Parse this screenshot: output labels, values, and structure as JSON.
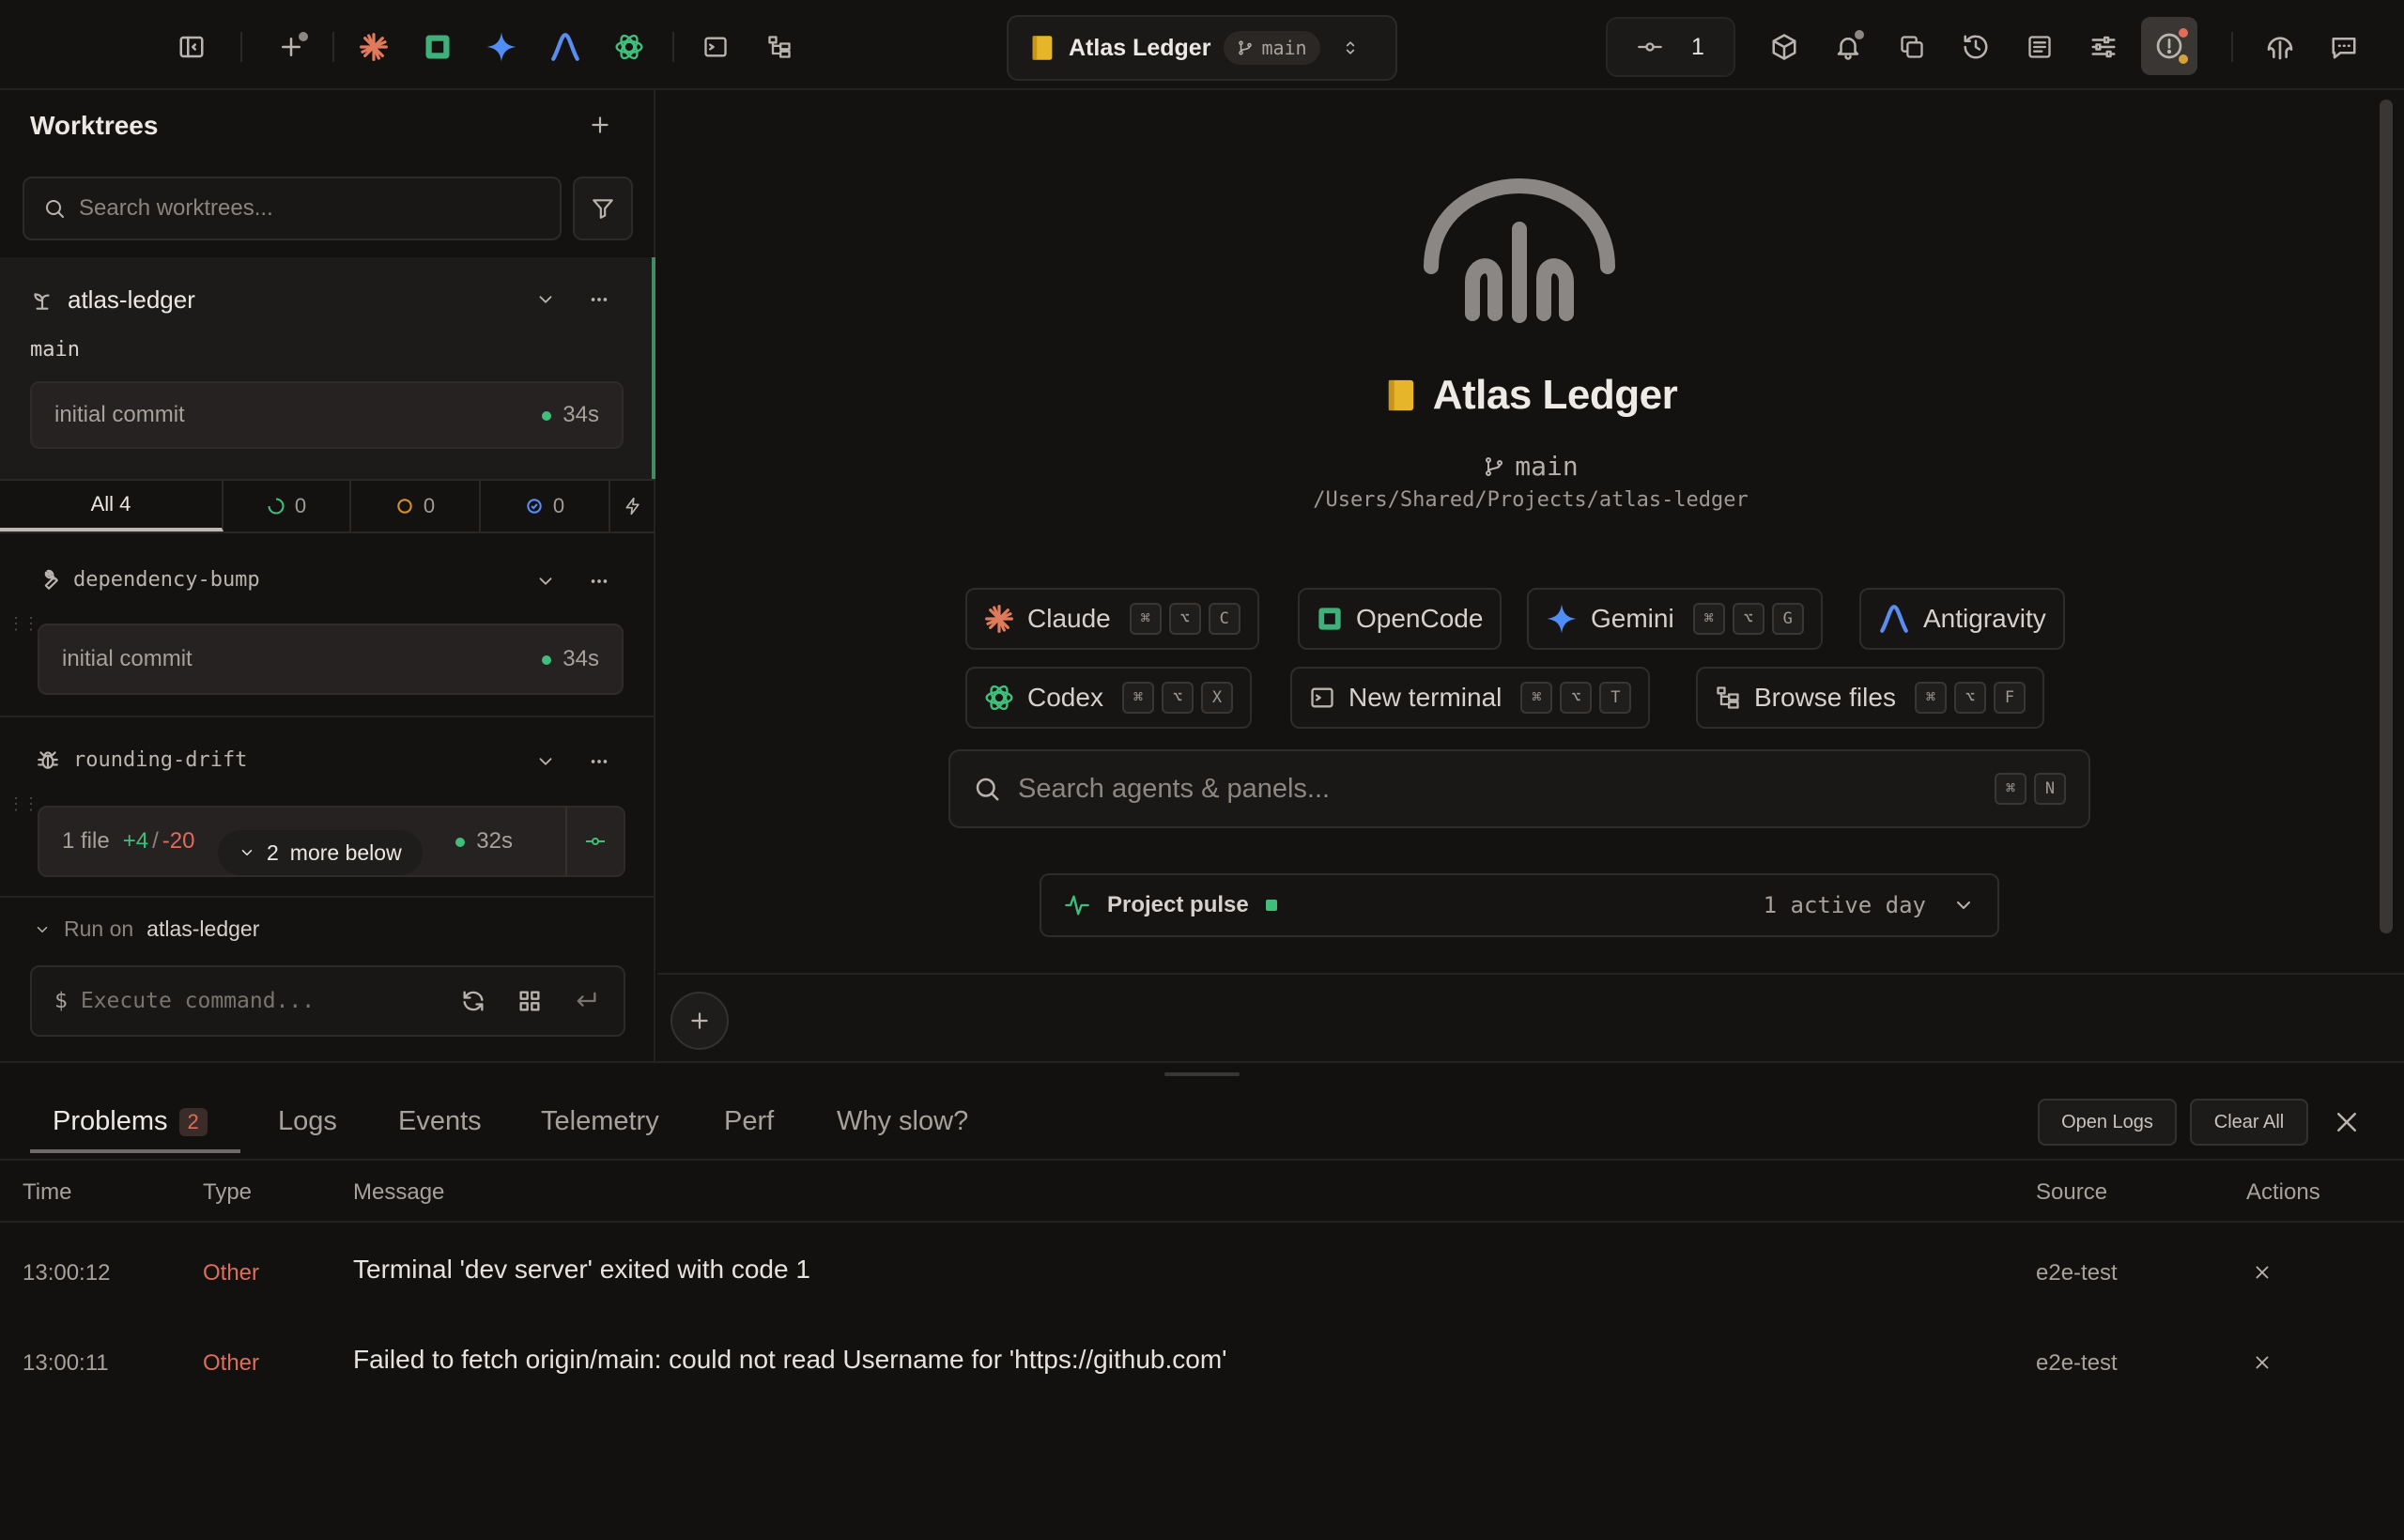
{
  "app": {
    "project_name": "Atlas Ledger",
    "branch": "main",
    "commit_counter": "1",
    "accent_green": "#3fbf7a",
    "error_red": "#e06c5a"
  },
  "toolbar": {
    "left_icons": [
      "sidebar-toggle-icon",
      "new-worktree-icon",
      "claude-icon",
      "opencode-icon",
      "gemini-icon",
      "antigravity-icon",
      "codex-icon",
      "terminal-icon",
      "file-tree-icon"
    ],
    "right_icons": [
      "box-icon",
      "bell-icon",
      "copy-icon",
      "history-icon",
      "list-icon",
      "sliders-icon",
      "alert-icon",
      "remote-icon",
      "chat-icon"
    ]
  },
  "sidebar": {
    "title": "Worktrees",
    "search_placeholder": "Search worktrees...",
    "main_worktree": {
      "name": "atlas-ledger",
      "branch": "main",
      "last_commit": "initial commit",
      "age": "34s"
    },
    "filters": [
      {
        "label": "All 4"
      },
      {
        "label": "0"
      },
      {
        "label": "0"
      },
      {
        "label": "0"
      }
    ],
    "worktrees": [
      {
        "name": "dependency-bump",
        "last_commit": "initial commit",
        "age": "34s"
      },
      {
        "name": "rounding-drift",
        "files": "1 file",
        "additions": "+4",
        "slash": "/",
        "deletions": "-20",
        "age": "32s"
      }
    ],
    "more_below_count": "2",
    "more_below_label": "more below",
    "run_on_label": "Run on",
    "run_on_target": "atlas-ledger",
    "command_prompt": "$",
    "command_placeholder": "Execute command..."
  },
  "main": {
    "title": "Atlas Ledger",
    "branch": "main",
    "path": "/Users/Shared/Projects/atlas-ledger",
    "agents": [
      {
        "label": "Claude",
        "keys": [
          "⌘",
          "⌥",
          "C"
        ]
      },
      {
        "label": "OpenCode",
        "keys": []
      },
      {
        "label": "Gemini",
        "keys": [
          "⌘",
          "⌥",
          "G"
        ]
      },
      {
        "label": "Antigravity",
        "keys": []
      },
      {
        "label": "Codex",
        "keys": [
          "⌘",
          "⌥",
          "X"
        ]
      },
      {
        "label": "New terminal",
        "keys": [
          "⌘",
          "⌥",
          "T"
        ]
      },
      {
        "label": "Browse files",
        "keys": [
          "⌘",
          "⌥",
          "F"
        ]
      }
    ],
    "search_placeholder": "Search agents & panels...",
    "search_keys": [
      "⌘",
      "N"
    ],
    "pulse_label": "Project pulse",
    "pulse_value": "1 active day"
  },
  "panel": {
    "tabs": [
      "Problems",
      "Logs",
      "Events",
      "Telemetry",
      "Perf",
      "Why slow?"
    ],
    "problems_count": "2",
    "open_logs": "Open Logs",
    "clear_all": "Clear All",
    "columns": [
      "Time",
      "Type",
      "Message",
      "Source",
      "Actions"
    ],
    "rows": [
      {
        "time": "13:00:12",
        "type": "Other",
        "message": "Terminal 'dev server' exited with code 1",
        "source": "e2e-test"
      },
      {
        "time": "13:00:11",
        "type": "Other",
        "message": "Failed to fetch origin/main: could not read Username for 'https://github.com'",
        "source": "e2e-test"
      }
    ]
  }
}
